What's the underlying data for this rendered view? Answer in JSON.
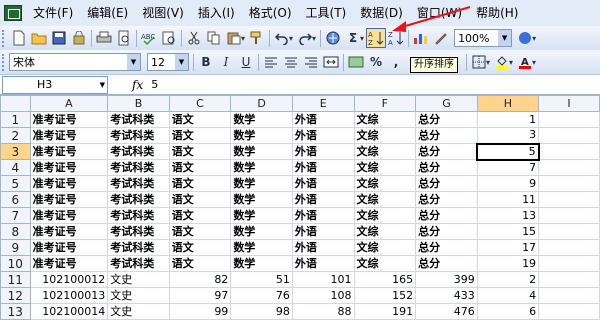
{
  "menu": [
    {
      "label": "文件(F)"
    },
    {
      "label": "编辑(E)"
    },
    {
      "label": "视图(V)"
    },
    {
      "label": "插入(I)"
    },
    {
      "label": "格式(O)"
    },
    {
      "label": "工具(T)"
    },
    {
      "label": "数据(D)"
    },
    {
      "label": "窗口(W)"
    },
    {
      "label": "帮助(H)"
    }
  ],
  "toolbar": {
    "sum_symbol": "Σ",
    "zoom": "100%",
    "help_symbol": "?",
    "sort_ascending_tooltip": "升序排序"
  },
  "format_toolbar": {
    "font": "宋体",
    "size": "12",
    "bold": "B",
    "italic": "I",
    "underline": "U",
    "percent": "%",
    "comma": ","
  },
  "formula_bar": {
    "name_box": "H3",
    "fx": "fx",
    "value": "5"
  },
  "sheet": {
    "columns": [
      "A",
      "B",
      "C",
      "D",
      "E",
      "F",
      "G",
      "H",
      "I"
    ],
    "selected_cell": "H3",
    "rows": [
      {
        "num": "1",
        "cells": [
          "准考证号",
          "考试科类",
          "语文",
          "数学",
          "外语",
          "文综",
          "总分",
          "1",
          ""
        ]
      },
      {
        "num": "2",
        "cells": [
          "准考证号",
          "考试科类",
          "语文",
          "数学",
          "外语",
          "文综",
          "总分",
          "3",
          ""
        ]
      },
      {
        "num": "3",
        "cells": [
          "准考证号",
          "考试科类",
          "语文",
          "数学",
          "外语",
          "文综",
          "总分",
          "5",
          ""
        ]
      },
      {
        "num": "4",
        "cells": [
          "准考证号",
          "考试科类",
          "语文",
          "数学",
          "外语",
          "文综",
          "总分",
          "7",
          ""
        ]
      },
      {
        "num": "5",
        "cells": [
          "准考证号",
          "考试科类",
          "语文",
          "数学",
          "外语",
          "文综",
          "总分",
          "9",
          ""
        ]
      },
      {
        "num": "6",
        "cells": [
          "准考证号",
          "考试科类",
          "语文",
          "数学",
          "外语",
          "文综",
          "总分",
          "11",
          ""
        ]
      },
      {
        "num": "7",
        "cells": [
          "准考证号",
          "考试科类",
          "语文",
          "数学",
          "外语",
          "文综",
          "总分",
          "13",
          ""
        ]
      },
      {
        "num": "8",
        "cells": [
          "准考证号",
          "考试科类",
          "语文",
          "数学",
          "外语",
          "文综",
          "总分",
          "15",
          ""
        ]
      },
      {
        "num": "9",
        "cells": [
          "准考证号",
          "考试科类",
          "语文",
          "数学",
          "外语",
          "文综",
          "总分",
          "17",
          ""
        ]
      },
      {
        "num": "10",
        "cells": [
          "准考证号",
          "考试科类",
          "语文",
          "数学",
          "外语",
          "文综",
          "总分",
          "19",
          ""
        ]
      },
      {
        "num": "11",
        "cells": [
          "102100012",
          "文史",
          "82",
          "51",
          "101",
          "165",
          "399",
          "2",
          ""
        ]
      },
      {
        "num": "12",
        "cells": [
          "102100013",
          "文史",
          "97",
          "76",
          "108",
          "152",
          "433",
          "4",
          ""
        ]
      },
      {
        "num": "13",
        "cells": [
          "102100014",
          "文史",
          "99",
          "98",
          "88",
          "191",
          "476",
          "6",
          ""
        ]
      }
    ]
  },
  "colors": {
    "arrow": "#e8141c",
    "selected_header": "#ffd58d",
    "highlight_button": "#ffe08f"
  }
}
